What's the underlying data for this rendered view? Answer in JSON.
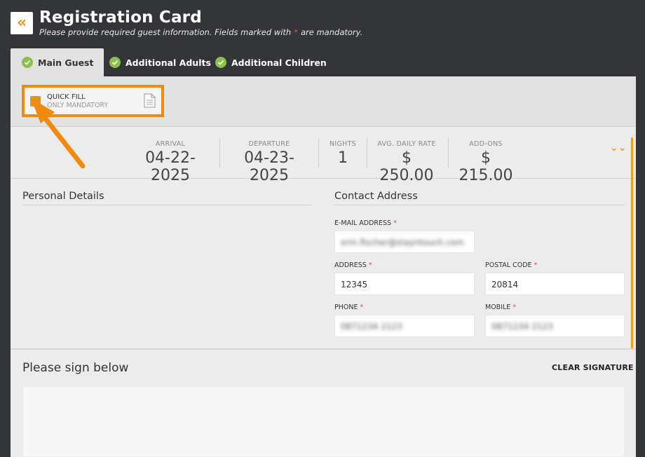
{
  "header": {
    "back_icon": "double-chevron-left-icon",
    "back_glyph": "«",
    "title": "Registration Card",
    "subtitle_pre": "Please provide required guest information. Fields marked with",
    "subtitle_req": "*",
    "subtitle_post": "are mandatory."
  },
  "tabs": [
    {
      "label": "Main Guest",
      "icon": "check-circle-icon"
    },
    {
      "label": "Additional Adults",
      "icon": "check-circle-icon"
    },
    {
      "label": "Additional Children",
      "icon": "check-circle-icon"
    }
  ],
  "quick_fill": {
    "label": "QUICK FILL",
    "sub": "ONLY MANDATORY",
    "icon": "document-icon"
  },
  "stay": {
    "arrival_label": "ARRIVAL",
    "arrival": "04-22-2025",
    "departure_label": "DEPARTURE",
    "departure": "04-23-2025",
    "nights_label": "NIGHTS",
    "nights": "1",
    "rate_label": "AVG. DAILY RATE",
    "rate": "$ 250.00",
    "addons_label": "ADD-ONS",
    "addons": "$ 215.00",
    "expand_glyph": "⌄⌄"
  },
  "personal": {
    "title": "Personal Details"
  },
  "contact": {
    "title": "Contact Address",
    "email_label": "E-MAIL ADDRESS",
    "email": "erin.fischer@stayntouch.com",
    "address_label": "ADDRESS",
    "address": "12345",
    "postal_label": "POSTAL CODE",
    "postal": "20814",
    "phone_label": "PHONE",
    "phone": "0871234 2123",
    "mobile_label": "MOBILE",
    "mobile": "0871234 2123",
    "req": "*"
  },
  "signature": {
    "title": "Please sign below",
    "clear": "CLEAR SIGNATURE"
  },
  "colors": {
    "accent": "#e8901a",
    "highlight": "#f28a0f",
    "check_green": "#8cc04b",
    "required": "#d9534f",
    "background": "#343538"
  }
}
